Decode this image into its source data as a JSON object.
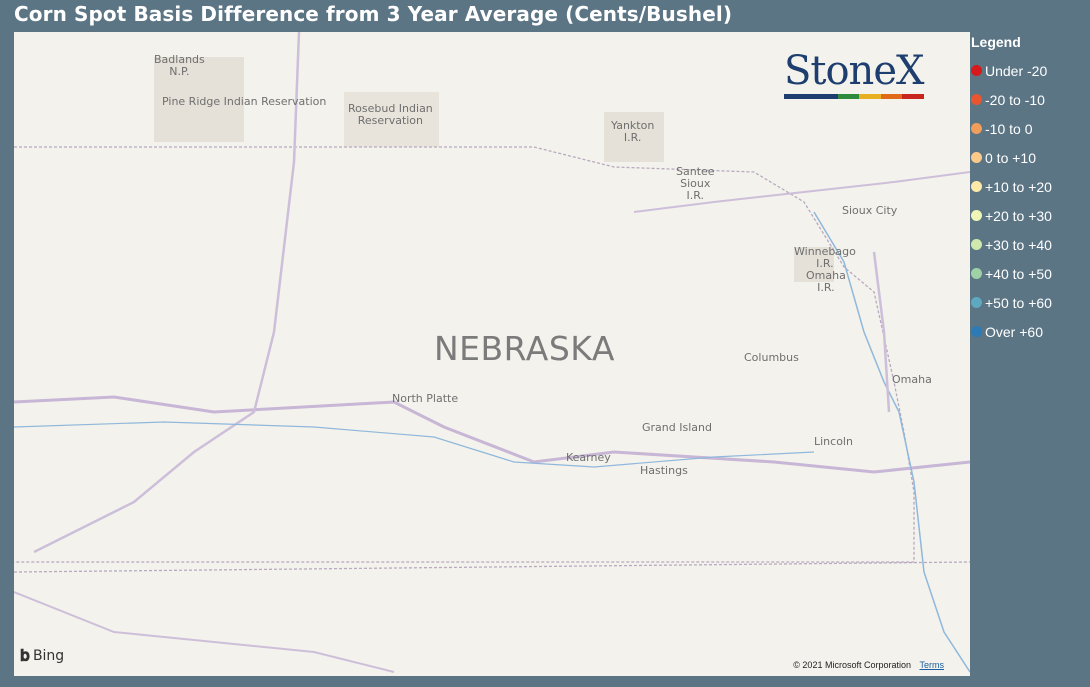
{
  "title": "Corn Spot Basis Difference from 3 Year Average (Cents/Bushel)",
  "map": {
    "state_label": "NEBRASKA",
    "places": [
      {
        "name": "Badlands\nN.P."
      },
      {
        "name": "Pine Ridge Indian Reservation"
      },
      {
        "name": "Rosebud Indian\nReservation"
      },
      {
        "name": "Yankton\nI.R."
      },
      {
        "name": "Santee\nSioux\nI.R."
      },
      {
        "name": "Sioux City"
      },
      {
        "name": "Winnebago\nI.R."
      },
      {
        "name": "Omaha\nI.R."
      },
      {
        "name": "Columbus"
      },
      {
        "name": "Omaha"
      },
      {
        "name": "North Platte"
      },
      {
        "name": "Grand Island"
      },
      {
        "name": "Kearney"
      },
      {
        "name": "Hastings"
      },
      {
        "name": "Lincoln"
      }
    ],
    "logo_text": "StoneX",
    "logo_colors": [
      "#1d3e6e",
      "#2e8b3e",
      "#e8b020",
      "#e06a1a",
      "#c8251f"
    ],
    "bing_label": "Bing",
    "copyright": "© 2021 Microsoft Corporation",
    "terms_label": "Terms"
  },
  "legend": {
    "title": "Legend",
    "items": [
      {
        "label": "Under -20",
        "color": "#d7191c"
      },
      {
        "label": "-20 to -10",
        "color": "#e8552f"
      },
      {
        "label": "-10 to 0",
        "color": "#f29e5a"
      },
      {
        "label": "0 to +10",
        "color": "#fbc98a"
      },
      {
        "label": "+10 to +20",
        "color": "#fdeaa8"
      },
      {
        "label": "+20 to +30",
        "color": "#f0f5b8"
      },
      {
        "label": "+30 to +40",
        "color": "#cfe8ae"
      },
      {
        "label": "+40 to +50",
        "color": "#9fd1a7"
      },
      {
        "label": "+50 to +60",
        "color": "#5ea9c0"
      },
      {
        "label": "Over +60",
        "color": "#2c7bb6"
      }
    ]
  }
}
